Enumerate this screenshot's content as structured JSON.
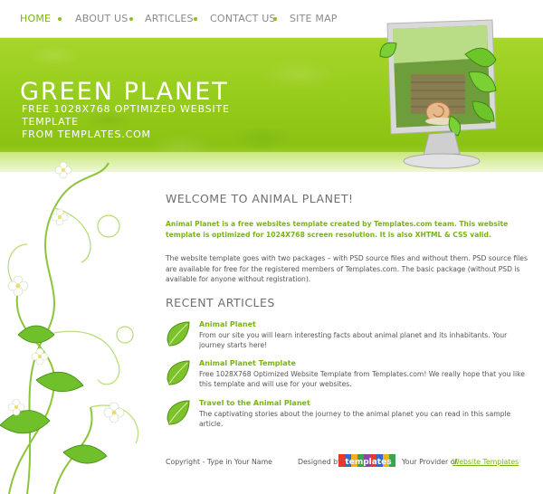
{
  "nav": {
    "items": [
      {
        "label": "HOME",
        "active": true
      },
      {
        "label": "ABOUT US",
        "active": false
      },
      {
        "label": "ARTICLES",
        "active": false
      },
      {
        "label": "CONTACT US",
        "active": false
      },
      {
        "label": "SITE MAP",
        "active": false
      }
    ]
  },
  "banner": {
    "title": "GREEN PLANET",
    "subtitle_line1": "FREE 1028X768 OPTIMIZED WEBSITE TEMPLATE",
    "subtitle_line2": "FROM TEMPLATES.COM"
  },
  "welcome": {
    "heading": "WELCOME TO ANIMAL PLANET!",
    "intro": "Animal Planet is a free websites template created by Templates.com team. This website template is optimized for 1024X768 screen resolution. It is also XHTML & CSS valid.",
    "body": "The website template goes with two packages – with PSD source files and without them. PSD source files are available for free for the registered members of Templates.com. The basic package (without PSD is available for anyone without registration)."
  },
  "recent": {
    "heading": "RECENT ARTICLES",
    "articles": [
      {
        "title": "Animal Planet",
        "text": "From our site you will learn interesting facts about animal planet and its inhabitants. Your journey starts here!"
      },
      {
        "title": "Animal Planet Template",
        "text": "Free 1028X768 Optimized Website Template from Templates.com! We really hope that you like this template and will use for your websites."
      },
      {
        "title": "Travel to the Animal Planet",
        "text": "The captivating stories about the journey to the animal planet you can read in this sample article."
      }
    ]
  },
  "footer": {
    "copyright": "Copyright - Type in Your Name",
    "designed_by": "Designed by:",
    "logo_text": "templates",
    "provider": "Your Provider of",
    "link": "Website Templates"
  },
  "colors": {
    "accent": "#78b312",
    "banner": "#96cc1b",
    "text": "#555555",
    "heading": "#6e6e6e"
  },
  "icons": [
    "leaf-icon",
    "monitor-illustration",
    "floral-vine-decoration",
    "templates-logo"
  ]
}
